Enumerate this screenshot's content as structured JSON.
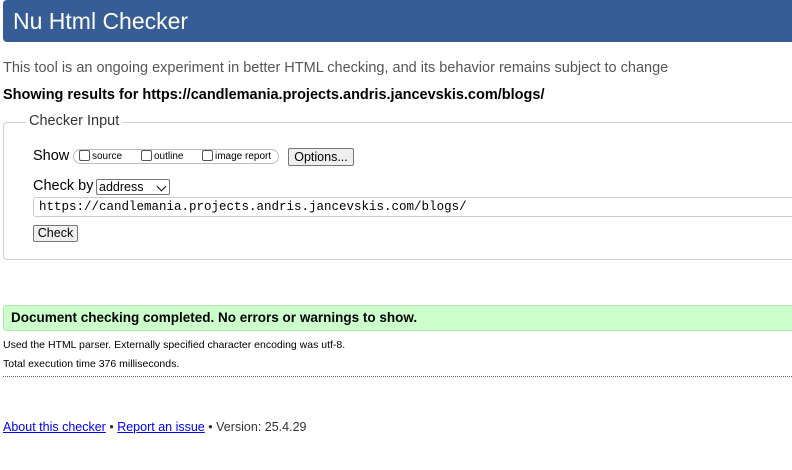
{
  "header": {
    "title": "Nu Html Checker"
  },
  "intro": "This tool is an ongoing experiment in better HTML checking, and its behavior remains subject to change",
  "results_line": "Showing results for https://candlemania.projects.andris.jancevskis.com/blogs/",
  "checker_input": {
    "legend": "Checker Input",
    "show_label": "Show",
    "options": [
      {
        "label": "source",
        "checked": false
      },
      {
        "label": "outline",
        "checked": false
      },
      {
        "label": "image report",
        "checked": false
      }
    ],
    "options_button": "Options...",
    "check_by_label": "Check by",
    "check_by_selected": "address",
    "url_value": "https://candlemania.projects.andris.jancevskis.com/blogs/",
    "check_button": "Check"
  },
  "result": {
    "message": "Document checking completed. No errors or warnings to show.",
    "color": "#ccffcc"
  },
  "details": [
    "Used the HTML parser. Externally specified character encoding was utf-8.",
    "Total execution time 376 milliseconds."
  ],
  "footer": {
    "about_link": "About this checker",
    "separator": "•",
    "report_link": "Report an issue",
    "version": "Version: 25.4.29"
  },
  "colors": {
    "header_bg": "#365d95",
    "link": "#0000ee"
  }
}
